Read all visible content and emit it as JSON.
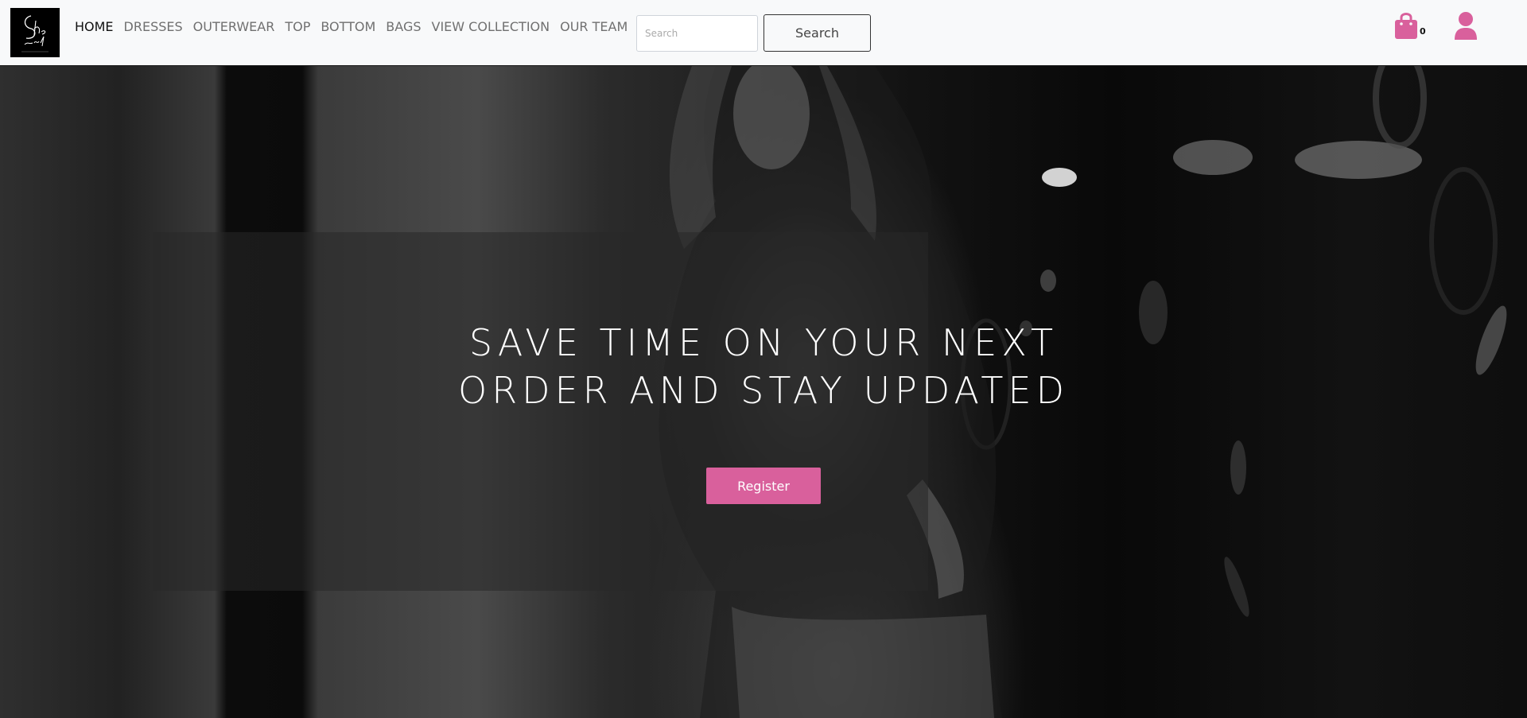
{
  "nav": {
    "brand_logo": "brand-logo",
    "links": [
      {
        "label": "HOME",
        "active": true
      },
      {
        "label": "DRESSES",
        "active": false
      },
      {
        "label": "OUTERWEAR",
        "active": false
      },
      {
        "label": "TOP",
        "active": false
      },
      {
        "label": "BOTTOM",
        "active": false
      },
      {
        "label": "BAGS",
        "active": false
      },
      {
        "label": "VIEW COLLECTION",
        "active": false
      },
      {
        "label": "OUR TEAM",
        "active": false
      }
    ],
    "search": {
      "placeholder": "Search",
      "value": "",
      "button_label": "Search"
    },
    "cart": {
      "icon": "shopping-bag-icon",
      "count": "0"
    },
    "user": {
      "icon": "user-icon"
    }
  },
  "hero": {
    "headline": "SAVE TIME ON YOUR NEXT ORDER AND STAY UPDATED",
    "button_label": "Register"
  },
  "colors": {
    "accent": "#d9609c",
    "navbar_bg": "#f8f9fa"
  }
}
